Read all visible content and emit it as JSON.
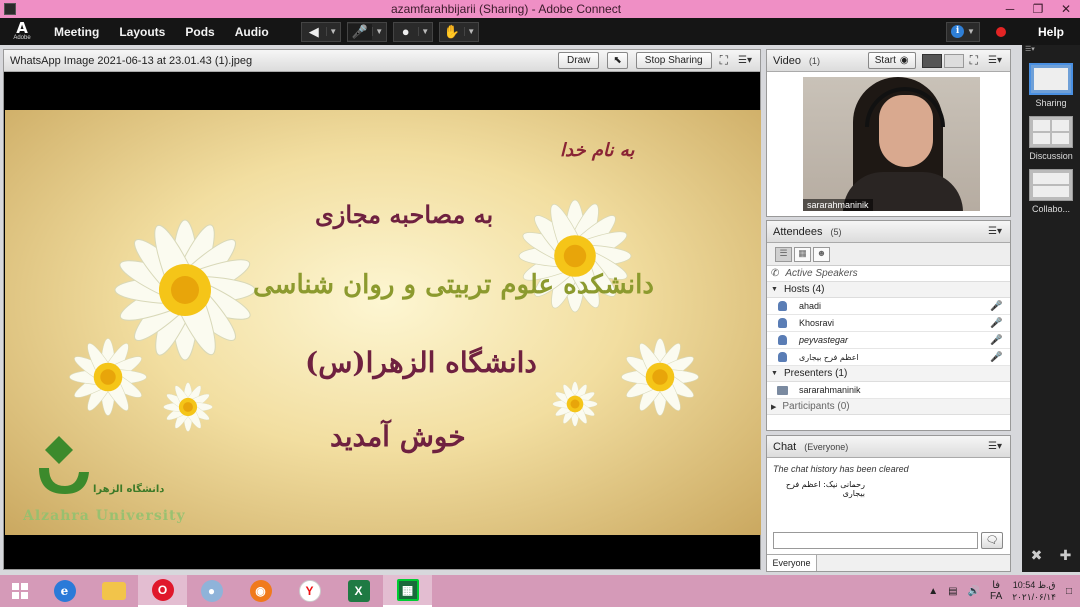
{
  "window": {
    "title": "azamfarahbijarii (Sharing) - Adobe Connect",
    "minimize": "─",
    "restore": "❐",
    "close": "✕"
  },
  "menubar": {
    "logo_mark": "A",
    "logo_text": "Adobe",
    "items": [
      "Meeting",
      "Layouts",
      "Pods",
      "Audio"
    ],
    "help": "Help"
  },
  "share_pod": {
    "title": "WhatsApp Image 2021-06-13 at 23.01.43 (1).jpeg",
    "draw_label": "Draw",
    "stop_label": "Stop Sharing"
  },
  "slide": {
    "line1": "به نام خدا",
    "line2": "به مصاحبه مجازی",
    "line3": "دانشکده علوم تربیتی و روان شناسی",
    "line4": "دانشگاه الزهرا(س)",
    "line5": "خوش آمدید",
    "univ_fa": "دانشگاه الزهرا",
    "univ_en": "Alzahra University"
  },
  "video_pod": {
    "title": "Video",
    "count": "(1)",
    "start_label": "Start",
    "camera_name": "sararahmaninik"
  },
  "attendees_pod": {
    "title": "Attendees",
    "count": "(5)",
    "active_speakers": "Active Speakers",
    "hosts_label": "Hosts (4)",
    "hosts": [
      {
        "name": "ahadi",
        "mic": "off"
      },
      {
        "name": "Khosravi",
        "mic": "on"
      },
      {
        "name": "peyvastegar",
        "mic": "off"
      },
      {
        "name": "اعظم فرح بیجاری",
        "mic": "off"
      }
    ],
    "presenters_label": "Presenters (1)",
    "presenters": [
      {
        "name": "sararahmaninik"
      }
    ],
    "participants_label": "Participants (0)"
  },
  "chat_pod": {
    "title": "Chat",
    "scope": "(Everyone)",
    "system_msg": "The chat history has been cleared",
    "message": "رحمانی نیک: اعظم فرح بیجاری",
    "footer_tab": "Everyone",
    "send_icon": "speech-bubble-icon"
  },
  "layouts": {
    "items": [
      {
        "label": "Sharing",
        "active": true
      },
      {
        "label": "Discussion",
        "active": false
      },
      {
        "label": "Collabo...",
        "active": false
      }
    ]
  },
  "taskbar": {
    "lang": "FA",
    "lang_fa": "فا",
    "time": "10:54 ق.ظ",
    "date": "۲۰۲۱/۰۶/۱۴"
  },
  "colors": {
    "titlebar": "#ef8fc5",
    "taskbar": "#d59ab8",
    "accent_blue": "#4a90e2",
    "record_red": "#e32424"
  }
}
